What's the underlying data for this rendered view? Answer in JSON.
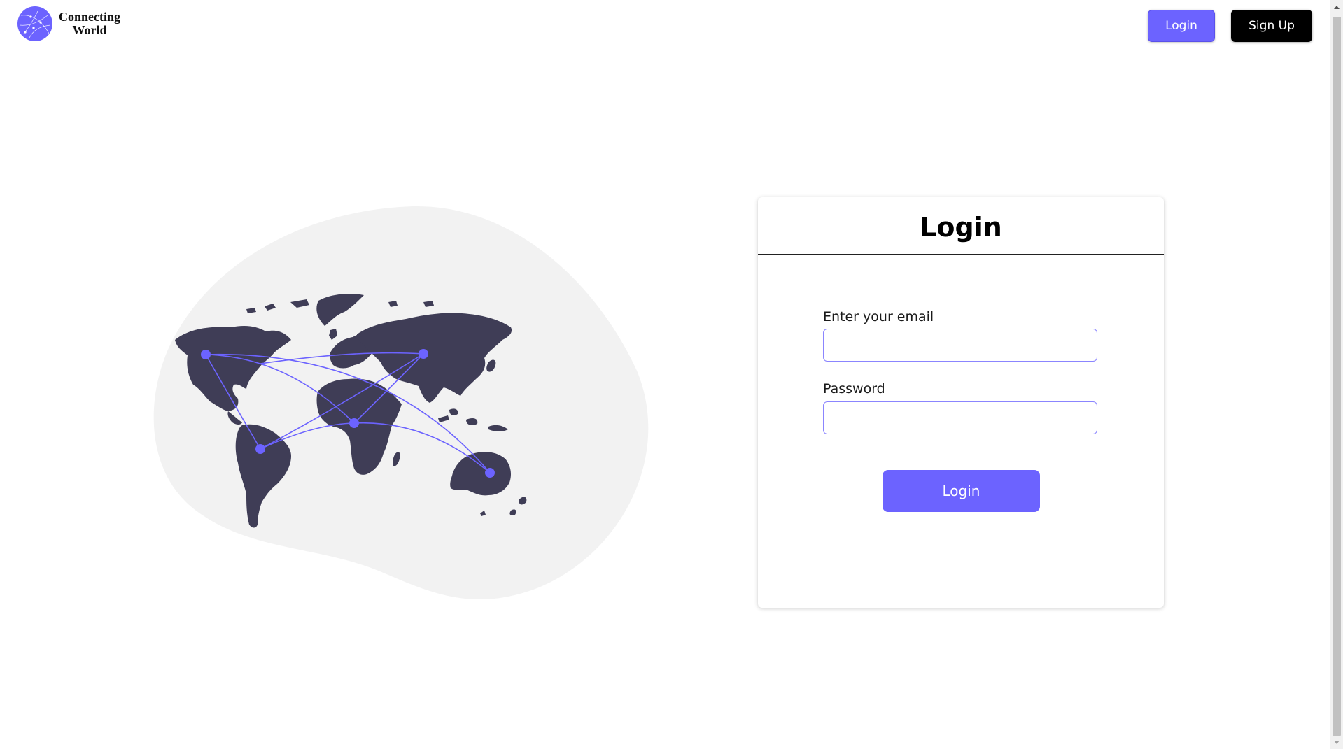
{
  "header": {
    "brand_line1": "Connecting",
    "brand_line2": "World",
    "logo_icon": "globe-network-icon",
    "login_label": "Login",
    "signup_label": "Sign Up"
  },
  "illustration": {
    "icon": "world-map-network-illustration"
  },
  "login_form": {
    "title": "Login",
    "email_label": "Enter your email",
    "email_value": "",
    "password_label": "Password",
    "password_value": "",
    "submit_label": "Login"
  },
  "colors": {
    "accent": "#6c63ff",
    "map_land": "#3f3d56",
    "blob": "#f2f2f2",
    "signup_bg": "#000000"
  }
}
